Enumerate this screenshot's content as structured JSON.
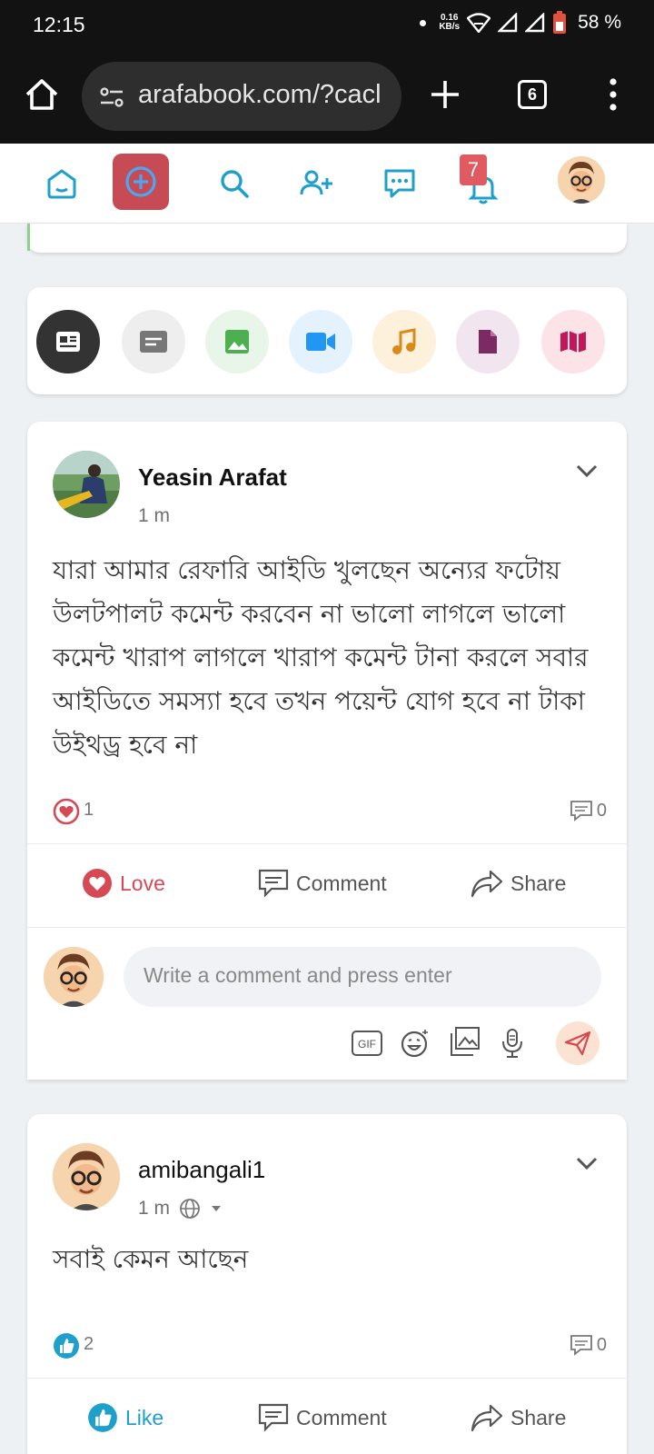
{
  "status_bar": {
    "time": "12:15",
    "net_speed_value": "0.16",
    "net_speed_unit": "KB/s",
    "battery": "58 %"
  },
  "browser": {
    "url": "arafabook.com/?cacl",
    "tab_count": "6"
  },
  "nav": {
    "notification_count": "7"
  },
  "post_types": [
    {
      "icon": "newspaper-icon",
      "bg": "#333333"
    },
    {
      "icon": "text-post-icon",
      "bg": "#eeeeee"
    },
    {
      "icon": "image-icon",
      "bg": "#e8f5e9"
    },
    {
      "icon": "video-icon",
      "bg": "#e3f2fd"
    },
    {
      "icon": "music-icon",
      "bg": "#fdf1dc"
    },
    {
      "icon": "file-icon",
      "bg": "#f1e6ef"
    },
    {
      "icon": "map-icon",
      "bg": "#fbe3e8"
    }
  ],
  "posts": [
    {
      "author": "Yeasin Arafat",
      "time": "1 m",
      "text": "যারা আমার রেফারি আইডি খুলছেন অন্যের ফটোয় উলটপালট কমেন্ট করবেন না ভালো লাগলে ভালো কমেন্ট খারাপ লাগলে খারাপ কমেন্ট টানা করলে সবার আইডিতে সমস্যা হবে তখন পয়েন্ট যোগ হবে না টাকা উইথড্র হবে না",
      "reaction_count": "1",
      "comment_count": "0",
      "react_label": "Love",
      "comment_label": "Comment",
      "share_label": "Share",
      "comment_placeholder": "Write a comment and press enter",
      "gif_label": "GIF"
    },
    {
      "author": "amibangali1",
      "time": "1 m",
      "text": "সবাই কেমন আছেন",
      "reaction_count": "2",
      "comment_count": "0",
      "react_label": "Like",
      "comment_label": "Comment",
      "share_label": "Share"
    }
  ],
  "colors": {
    "accent_blue": "#1e9fcc",
    "love_red": "#d54a55",
    "create_btn": "#c74b55"
  }
}
